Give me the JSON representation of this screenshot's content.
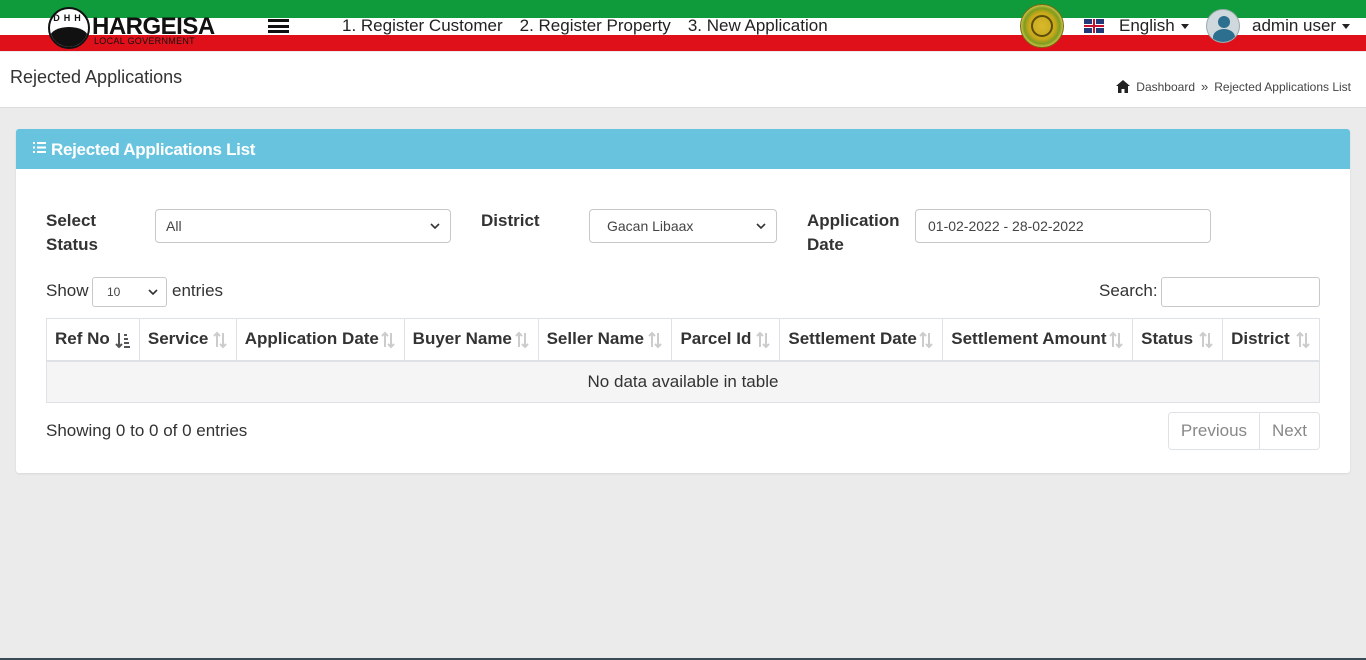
{
  "navbar": {
    "logo_title": "HARGEISA",
    "logo_subtitle": "LOCAL GOVERNMENT",
    "logo_letters": "DHH",
    "links": [
      "1. Register Customer",
      "2. Register Property",
      "3. New Application"
    ],
    "language": "English",
    "user": "admin user",
    "colors": {
      "green": "#0f9a3c",
      "white": "#ffffff",
      "red": "#e0101b"
    }
  },
  "page": {
    "title": "Rejected Applications",
    "breadcrumb": [
      "Dashboard",
      "Rejected Applications List"
    ]
  },
  "card": {
    "title": "Rejected Applications List",
    "header_color": "#68c4de"
  },
  "filters": {
    "status_label_1": "Select",
    "status_label_2": "Status",
    "status_value": "All",
    "district_label": "District",
    "district_value": "Gacan Libaax",
    "date_label_1": "Application",
    "date_label_2": "Date",
    "date_value": "01-02-2022 - 28-02-2022"
  },
  "table_controls": {
    "show": "Show",
    "entries": "entries",
    "page_size": "10",
    "search_label": "Search:"
  },
  "table": {
    "columns": [
      "Ref No",
      "Service",
      "Application Date",
      "Buyer Name",
      "Seller Name",
      "Parcel Id",
      "Settlement Date",
      "Settlement Amount",
      "Status",
      "District"
    ],
    "empty_message": "No data available in table"
  },
  "pagination": {
    "info": "Showing 0 to 0 of 0 entries",
    "previous": "Previous",
    "next": "Next"
  }
}
